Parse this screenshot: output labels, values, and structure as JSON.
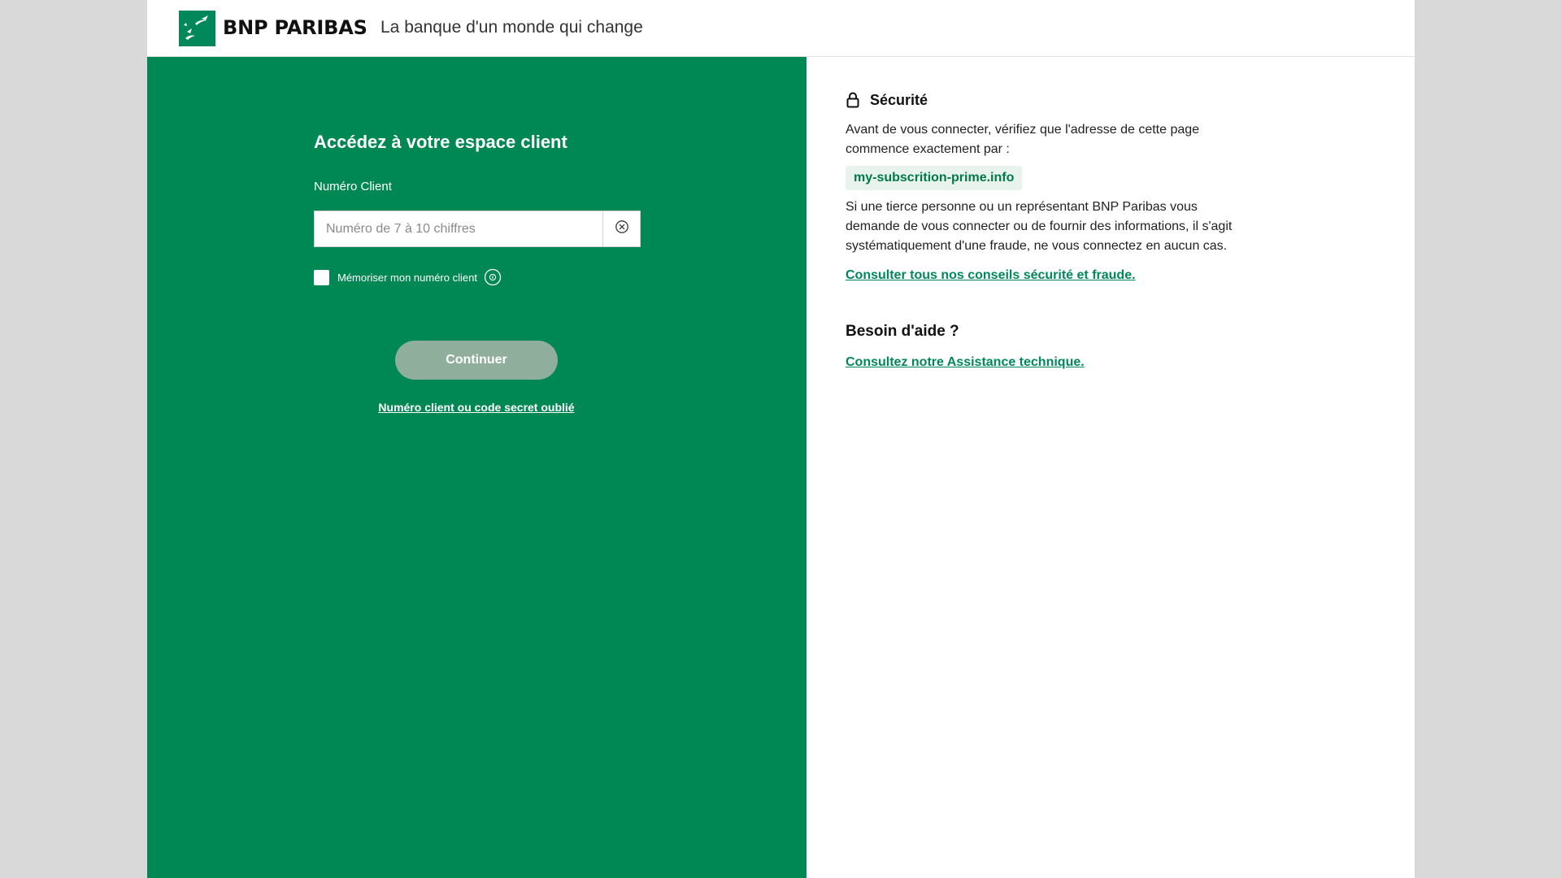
{
  "header": {
    "logo_text": "BNP PARIBAS",
    "tagline": "La banque d'un monde qui change"
  },
  "login": {
    "title": "Accédez à votre espace client",
    "field_label": "Numéro Client",
    "input_placeholder": "Numéro de 7 à 10 chiffres",
    "input_value": "",
    "remember_label": "Mémoriser mon numéro client",
    "remember_checked": false,
    "continue_label": "Continuer",
    "forgot_link": "Numéro client ou code secret oublié"
  },
  "security": {
    "title": "Sécurité",
    "intro": "Avant de vous connecter, vérifiez que l'adresse de cette page commence exactement par :",
    "domain": "my-subscrition-prime.info",
    "warning": "Si une tierce personne ou un représentant BNP Paribas vous demande de vous connecter ou de fournir des informations, il s'agit systématiquement d'une fraude, ne vous connectez en aucun cas.",
    "advice_link": "Consulter tous nos conseils sécurité et fraude."
  },
  "help": {
    "title": "Besoin d'aide ?",
    "assistance_link": "Consultez notre Assistance technique."
  },
  "colors": {
    "brand_green": "#008854",
    "button_disabled": "#8fae9b",
    "page_background": "#d9d9d9"
  },
  "icons": {
    "logo": "bnp-stars-birds-logo",
    "clear": "clear-circle-x-icon",
    "info": "info-circle-icon",
    "lock": "lock-icon"
  }
}
